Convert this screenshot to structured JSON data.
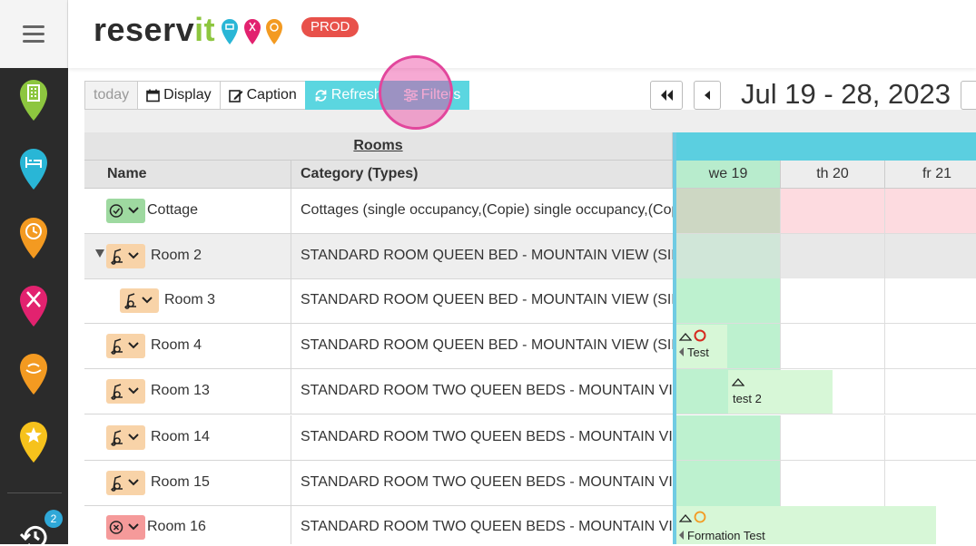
{
  "app": {
    "logo_main": "reserv",
    "logo_accent": "it",
    "env": "PROD",
    "notifications": "2"
  },
  "sidebar": {
    "items": [
      {
        "name": "building-icon",
        "color": "#8dc63f"
      },
      {
        "name": "bed-icon",
        "color": "#29b6d6"
      },
      {
        "name": "clock-icon",
        "color": "#f39a21"
      },
      {
        "name": "restaurant-icon",
        "color": "#e2226f"
      },
      {
        "name": "spa-icon",
        "color": "#f39a21"
      },
      {
        "name": "star-icon",
        "color": "#f6c21c"
      }
    ]
  },
  "toolbar": {
    "today": "today",
    "display": "Display",
    "caption": "Caption",
    "refresh": "Refresh",
    "filters": "Filters"
  },
  "date_range": "Jul 19 - 28, 2023",
  "table": {
    "rooms_header": "Rooms",
    "col_name": "Name",
    "col_category": "Category (Types)",
    "days": [
      "we 19",
      "th 20",
      "fr 21"
    ],
    "rows": [
      {
        "name": "Cottage",
        "category": "Cottages (single occupancy,(Copie) single occupancy,(Copie) double occupancy)",
        "status": "clean",
        "indent": 0
      },
      {
        "name": "Room 2",
        "category": "STANDARD ROOM QUEEN BED - MOUNTAIN VIEW (SINGLE OCCUPANCY)",
        "status": "dirty",
        "indent": 0,
        "expanded": true
      },
      {
        "name": "Room 3",
        "category": "STANDARD ROOM QUEEN BED - MOUNTAIN VIEW (SINGLE OCCUPANCY)",
        "status": "dirty",
        "indent": 1
      },
      {
        "name": "Room 4",
        "category": "STANDARD ROOM QUEEN BED - MOUNTAIN VIEW (SINGLE OCCUPANCY)",
        "status": "dirty",
        "indent": 0
      },
      {
        "name": "Room 13",
        "category": "STANDARD ROOM TWO QUEEN BEDS - MOUNTAIN VIEW (TWIN)",
        "status": "dirty",
        "indent": 0
      },
      {
        "name": "Room 14",
        "category": "STANDARD ROOM TWO QUEEN BEDS - MOUNTAIN VIEW (TWIN)",
        "status": "dirty",
        "indent": 0
      },
      {
        "name": "Room 15",
        "category": "STANDARD ROOM TWO QUEEN BEDS - MOUNTAIN VIEW (TWIN)",
        "status": "dirty",
        "indent": 0
      },
      {
        "name": "Room 16",
        "category": "STANDARD ROOM TWO QUEEN BEDS - MOUNTAIN VIEW (TWIN)",
        "status": "out-of-order",
        "indent": 0
      }
    ]
  },
  "bookings": [
    {
      "label": "Test",
      "row": 3
    },
    {
      "label": "test 2",
      "row": 4
    },
    {
      "label": "Formation Test",
      "row": 7
    }
  ],
  "colors": {
    "status_clean": "#9ed9a0",
    "status_dirty": "#f8d3a8",
    "status_ooo": "#f59a9a",
    "accent": "#5bd6e0",
    "day_green": "#bdf1cf",
    "day_pink": "#fddbe0"
  }
}
